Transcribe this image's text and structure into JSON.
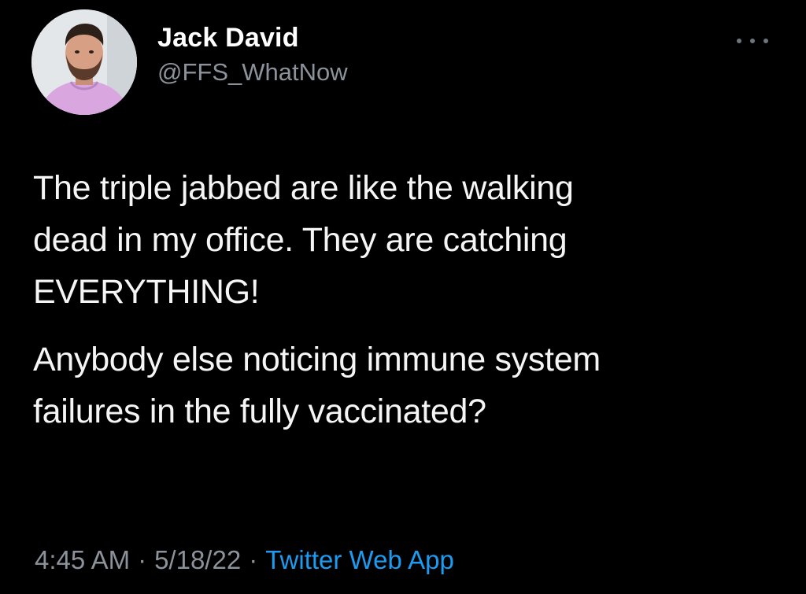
{
  "tweet": {
    "author": {
      "display_name": "Jack David",
      "handle": "@FFS_WhatNow",
      "avatar_icon": "user-avatar-photo"
    },
    "more_icon": "ellipsis-icon",
    "paragraphs": [
      "The triple jabbed are like the walking\ndead in my office. They are catching\nEVERYTHING!",
      "Anybody else noticing immune system\nfailures in the fully vaccinated?"
    ],
    "time": "4:45 AM",
    "date": "5/18/22",
    "separator": "·",
    "source": "Twitter Web App"
  },
  "colors": {
    "background": "#000000",
    "text": "#f5f5f5",
    "secondary": "#8b9299",
    "link": "#1d9bf0"
  }
}
